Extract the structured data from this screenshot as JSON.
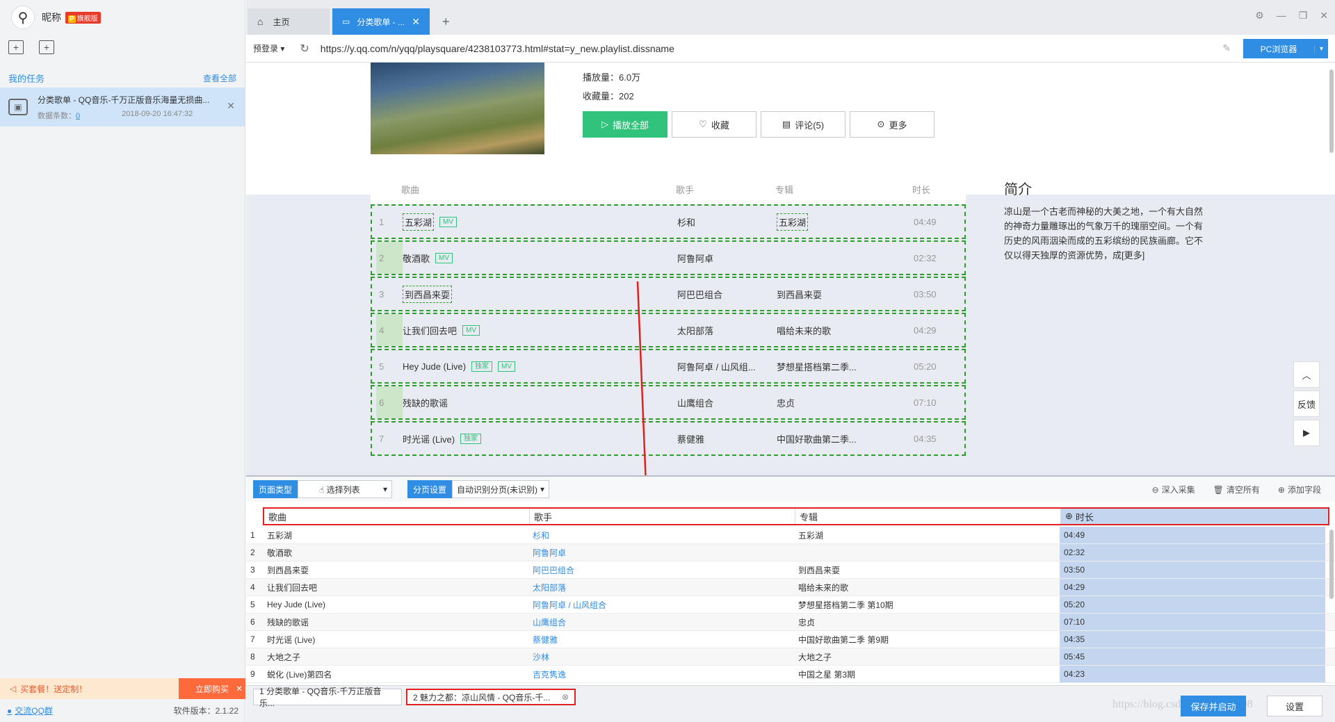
{
  "sidebar": {
    "nickname": "昵称",
    "vip_badge": "旗舰版",
    "vip_prefix": "P",
    "tasks_title": "我的任务",
    "view_all": "查看全部",
    "task": {
      "name": "分类歌单 - QQ音乐-千万正版音乐海量无损曲...",
      "count_label": "数据条数：",
      "count": "0",
      "time": "2018-09-20 16:47:32"
    },
    "promo_text": "买套餐！送定制！",
    "promo_button": "立即购买",
    "qq_group": "交流QQ群",
    "version": "软件版本：2.1.22"
  },
  "tabs": {
    "home": "主页",
    "active": "分类歌单 - ..."
  },
  "address": {
    "prelogin": "预登录",
    "url": "https://y.qq.com/n/yqq/playsquare/4238103773.html#stat=y_new.playlist.dissname",
    "browser_button": "PC浏览器"
  },
  "page": {
    "plays": "播放量：6.0万",
    "favorites": "收藏量：202",
    "buttons": [
      "播放全部",
      "收藏",
      "评论(5)",
      "更多"
    ],
    "intro_title": "简介",
    "intro_text": "凉山是一个古老而神秘的大美之地，一个有大自然的神奇力量雕琢出的气象万千的瑰丽空间。一个有历史的风雨洇染而成的五彩缤纷的民族画廊。它不仅以得天独厚的资源优势，成[更多]",
    "float_feedback": "反馈",
    "song_header": {
      "song": "歌曲",
      "singer": "歌手",
      "album": "专辑",
      "duration": "时长"
    },
    "songs": [
      {
        "num": "1",
        "name": "五彩湖",
        "tags": [
          "MV"
        ],
        "singer": "杉和",
        "album": "五彩湖",
        "dur": "04:49"
      },
      {
        "num": "2",
        "name": "敬酒歌",
        "tags": [
          "MV"
        ],
        "singer": "阿鲁阿卓",
        "album": "",
        "dur": "02:32"
      },
      {
        "num": "3",
        "name": "到西昌来耍",
        "tags": [],
        "singer": "阿巴巴组合",
        "album": "到西昌来耍",
        "dur": "03:50"
      },
      {
        "num": "4",
        "name": "让我们回去吧",
        "tags": [
          "MV"
        ],
        "singer": "太阳部落",
        "album": "唱给未来的歌",
        "dur": "04:29"
      },
      {
        "num": "5",
        "name": "Hey Jude (Live)",
        "tags": [
          "独家",
          "MV"
        ],
        "singer": "阿鲁阿卓 / 山风组...",
        "album": "梦想星搭档第二季...",
        "dur": "05:20"
      },
      {
        "num": "6",
        "name": "残缺的歌谣",
        "tags": [],
        "singer": "山鹰组合",
        "album": "忠贞",
        "dur": "07:10"
      },
      {
        "num": "7",
        "name": "时光谣 (Live)",
        "tags": [
          "独家"
        ],
        "singer": "蔡健雅",
        "album": "中国好歌曲第二季...",
        "dur": "04:35"
      }
    ]
  },
  "panel": {
    "page_type_label": "页面类型",
    "page_type_value": "选择列表",
    "paging_label": "分页设置",
    "paging_value": "自动识别分页(未识别)",
    "deep_collect": "深入采集",
    "clear_all": "清空所有",
    "add_field": "添加字段",
    "columns": [
      "歌曲",
      "歌手",
      "专辑",
      "时长"
    ],
    "rows": [
      [
        "1",
        "五彩湖",
        "杉和",
        "五彩湖",
        "04:49"
      ],
      [
        "2",
        "敬酒歌",
        "阿鲁阿卓",
        "",
        "02:32"
      ],
      [
        "3",
        "到西昌来耍",
        "阿巴巴组合",
        "到西昌来耍",
        "03:50"
      ],
      [
        "4",
        "让我们回去吧",
        "太阳部落",
        "唱给未来的歌",
        "04:29"
      ],
      [
        "5",
        "Hey Jude (Live)",
        "阿鲁阿卓 / 山风组合",
        "梦想星搭档第二季 第10期",
        "05:20"
      ],
      [
        "6",
        "残缺的歌谣",
        "山鹰组合",
        "忠贞",
        "07:10"
      ],
      [
        "7",
        "时光谣 (Live)",
        "蔡健雅",
        "中国好歌曲第二季 第9期",
        "04:35"
      ],
      [
        "8",
        "大地之子",
        "沙林",
        "大地之子",
        "05:45"
      ],
      [
        "9",
        "蜕化 (Live)第四名",
        "吉克隽逸",
        "中国之星 第3期",
        "04:23"
      ]
    ]
  },
  "bottom": {
    "tab1": "1 分类歌单 - QQ音乐-千万正版音乐...",
    "tab2": "2 魅力之都：凉山风情 - QQ音乐-千...",
    "save_button": "保存并启动",
    "settings_button": "设置",
    "watermark": "https://blog.csdn.net/a_jdnu998"
  },
  "colors": {
    "accent": "#2f8de4",
    "green": "#31c27c",
    "highlight_red": "#e02020"
  }
}
